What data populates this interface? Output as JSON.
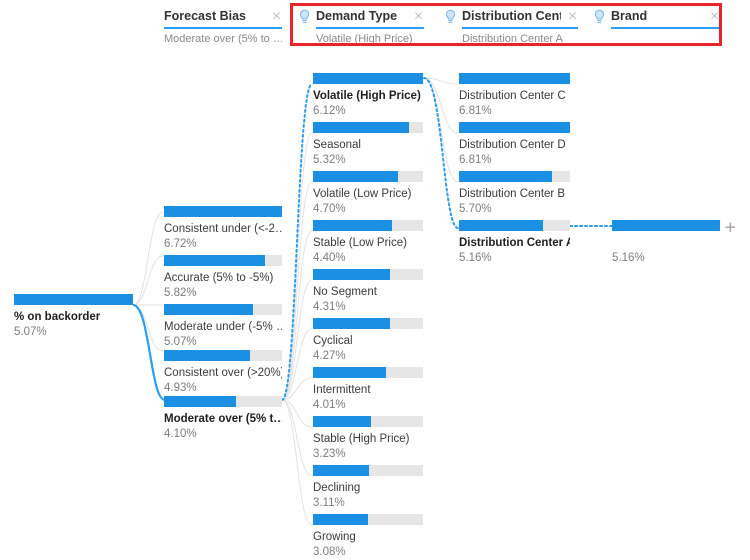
{
  "colors": {
    "bar_fill": "#1a8fe3",
    "bar_track": "#e6e6e6",
    "accent_underline": "#2a9df4",
    "highlight_box": "#e8242a",
    "selected_link": "#2a9df4",
    "link": "#e0e0e0",
    "bulb": "#7fb8ef"
  },
  "levels": [
    {
      "id": "forecast-bias",
      "title": "Forecast Bias",
      "subtitle": "Moderate over (5% to …",
      "close_label": "×",
      "has_bulb": false,
      "highlighted": false
    },
    {
      "id": "demand-type",
      "title": "Demand Type",
      "subtitle": "Volatile (High Price)",
      "close_label": "×",
      "has_bulb": true,
      "bulb_icon": "lightbulb-icon",
      "highlighted": true
    },
    {
      "id": "distribution-center",
      "title": "Distribution Cent…",
      "subtitle": "Distribution Center A",
      "close_label": "×",
      "has_bulb": true,
      "bulb_icon": "lightbulb-icon",
      "highlighted": true
    },
    {
      "id": "brand",
      "title": "Brand",
      "subtitle": "",
      "close_label": "×",
      "has_bulb": true,
      "bulb_icon": "lightbulb-icon",
      "highlighted": true
    }
  ],
  "root": {
    "label": "% on backorder",
    "value": "5.07%",
    "fill_pct": 100,
    "selected": true
  },
  "columns": [
    {
      "id": "forecast-bias",
      "nodes": [
        {
          "label": "Consistent under (<-2…",
          "value": "6.72%",
          "fill_pct": 100,
          "selected": false
        },
        {
          "label": "Accurate (5% to -5%)",
          "value": "5.82%",
          "fill_pct": 86,
          "selected": false
        },
        {
          "label": "Moderate under (-5% …",
          "value": "5.07%",
          "fill_pct": 75,
          "selected": false
        },
        {
          "label": "Consistent over (>20%)",
          "value": "4.93%",
          "fill_pct": 73,
          "selected": false
        },
        {
          "label": "Moderate over (5% t…",
          "value": "4.10%",
          "fill_pct": 61,
          "selected": true
        }
      ]
    },
    {
      "id": "demand-type",
      "nodes": [
        {
          "label": "Volatile (High Price)",
          "value": "6.12%",
          "fill_pct": 100,
          "selected": true
        },
        {
          "label": "Seasonal",
          "value": "5.32%",
          "fill_pct": 87,
          "selected": false
        },
        {
          "label": "Volatile (Low Price)",
          "value": "4.70%",
          "fill_pct": 77,
          "selected": false
        },
        {
          "label": "Stable (Low Price)",
          "value": "4.40%",
          "fill_pct": 72,
          "selected": false
        },
        {
          "label": "No Segment",
          "value": "4.31%",
          "fill_pct": 70,
          "selected": false
        },
        {
          "label": "Cyclical",
          "value": "4.27%",
          "fill_pct": 70,
          "selected": false
        },
        {
          "label": "Intermittent",
          "value": "4.01%",
          "fill_pct": 66,
          "selected": false
        },
        {
          "label": "Stable (High Price)",
          "value": "3.23%",
          "fill_pct": 53,
          "selected": false
        },
        {
          "label": "Declining",
          "value": "3.11%",
          "fill_pct": 51,
          "selected": false
        },
        {
          "label": "Growing",
          "value": "3.08%",
          "fill_pct": 50,
          "selected": false
        }
      ]
    },
    {
      "id": "distribution-center",
      "nodes": [
        {
          "label": "Distribution Center C",
          "value": "6.81%",
          "fill_pct": 100,
          "selected": false
        },
        {
          "label": "Distribution Center D",
          "value": "6.81%",
          "fill_pct": 100,
          "selected": false
        },
        {
          "label": "Distribution Center B",
          "value": "5.70%",
          "fill_pct": 84,
          "selected": false
        },
        {
          "label": "Distribution Center A",
          "value": "5.16%",
          "fill_pct": 76,
          "selected": true
        }
      ]
    },
    {
      "id": "brand",
      "nodes": [
        {
          "label": "",
          "value": "5.16%",
          "fill_pct": 100,
          "selected": false
        }
      ]
    }
  ],
  "add_level_button": {
    "label": "+",
    "name": "add-level-button"
  }
}
